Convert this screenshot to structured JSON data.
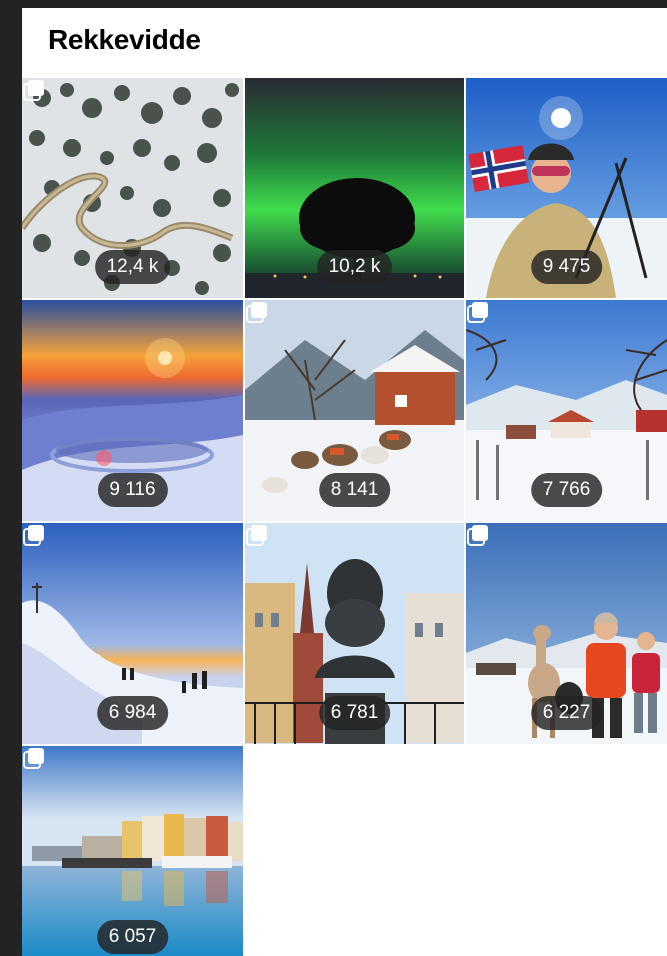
{
  "header": {
    "title": "Rekkevidde"
  },
  "posts": [
    {
      "reach": "12,4 k",
      "multi": true,
      "icon": "forest-road-aerial"
    },
    {
      "reach": "10,2 k",
      "multi": false,
      "icon": "northern-lights-tree"
    },
    {
      "reach": "9 475",
      "multi": false,
      "icon": "skier-norwegian-flag-selfie"
    },
    {
      "reach": "9 116",
      "multi": false,
      "icon": "sunset-snow-platform"
    },
    {
      "reach": "8 141",
      "multi": true,
      "icon": "goats-farm-winter"
    },
    {
      "reach": "7 766",
      "multi": true,
      "icon": "snowy-village-valley"
    },
    {
      "reach": "6 984",
      "multi": true,
      "icon": "mountain-ridge-hikers"
    },
    {
      "reach": "6 781",
      "multi": true,
      "icon": "henrik-ibsen-bust"
    },
    {
      "reach": "6 227",
      "multi": true,
      "icon": "alpaca-walk-snow"
    },
    {
      "reach": "6 057",
      "multi": true,
      "icon": "harbor-town-reflection"
    }
  ]
}
